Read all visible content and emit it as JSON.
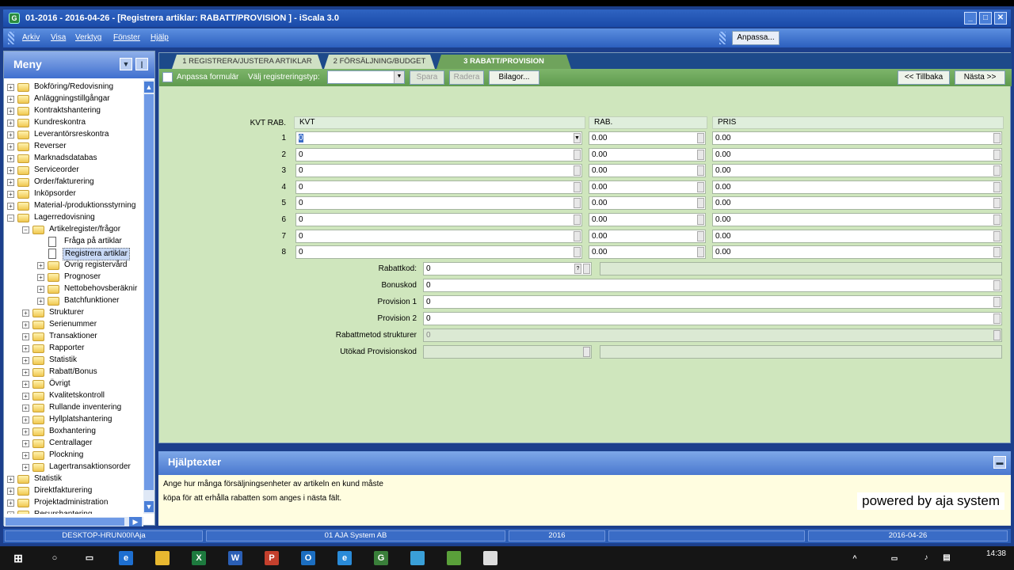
{
  "window": {
    "title": "01-2016 - 2016-04-26 - [Registrera artiklar: RABATT/PROVISION  ] - iScala 3.0"
  },
  "menubar": {
    "items": [
      "Arkiv",
      "Visa",
      "Verktyg",
      "Fönster",
      "Hjälp"
    ],
    "anpassa_label": "Anpassa..."
  },
  "sidebar": {
    "title": "Meny",
    "tree": [
      {
        "label": "Bokföring/Redovisning",
        "level": 0,
        "type": "folder",
        "expanded": false
      },
      {
        "label": "Anläggningstillgångar",
        "level": 0,
        "type": "folder",
        "expanded": false
      },
      {
        "label": "Kontraktshantering",
        "level": 0,
        "type": "folder",
        "expanded": false
      },
      {
        "label": "Kundreskontra",
        "level": 0,
        "type": "folder",
        "expanded": false
      },
      {
        "label": "Leverantörsreskontra",
        "level": 0,
        "type": "folder",
        "expanded": false
      },
      {
        "label": "Reverser",
        "level": 0,
        "type": "folder",
        "expanded": false
      },
      {
        "label": "Marknadsdatabas",
        "level": 0,
        "type": "folder",
        "expanded": false
      },
      {
        "label": "Serviceorder",
        "level": 0,
        "type": "folder",
        "expanded": false
      },
      {
        "label": "Order/fakturering",
        "level": 0,
        "type": "folder",
        "expanded": false
      },
      {
        "label": "Inköpsorder",
        "level": 0,
        "type": "folder",
        "expanded": false
      },
      {
        "label": "Material-/produktionsstyrning",
        "level": 0,
        "type": "folder",
        "expanded": false
      },
      {
        "label": "Lagerredovisning",
        "level": 0,
        "type": "folder",
        "expanded": true
      },
      {
        "label": "Artikelregister/frågor",
        "level": 1,
        "type": "folder",
        "expanded": true
      },
      {
        "label": "Fråga på artiklar",
        "level": 2,
        "type": "doc"
      },
      {
        "label": "Registrera artiklar",
        "level": 2,
        "type": "doc",
        "selected": true
      },
      {
        "label": "Övrig registervård",
        "level": 2,
        "type": "folder",
        "expanded": false
      },
      {
        "label": "Prognoser",
        "level": 2,
        "type": "folder",
        "expanded": false
      },
      {
        "label": "Nettobehovsberäknir",
        "level": 2,
        "type": "folder",
        "expanded": false
      },
      {
        "label": "Batchfunktioner",
        "level": 2,
        "type": "folder",
        "expanded": false
      },
      {
        "label": "Strukturer",
        "level": 1,
        "type": "folder",
        "expanded": false
      },
      {
        "label": "Serienummer",
        "level": 1,
        "type": "folder",
        "expanded": false
      },
      {
        "label": "Transaktioner",
        "level": 1,
        "type": "folder",
        "expanded": false
      },
      {
        "label": "Rapporter",
        "level": 1,
        "type": "folder",
        "expanded": false
      },
      {
        "label": "Statistik",
        "level": 1,
        "type": "folder",
        "expanded": false
      },
      {
        "label": "Rabatt/Bonus",
        "level": 1,
        "type": "folder",
        "expanded": false
      },
      {
        "label": "Övrigt",
        "level": 1,
        "type": "folder",
        "expanded": false
      },
      {
        "label": "Kvalitetskontroll",
        "level": 1,
        "type": "folder",
        "expanded": false
      },
      {
        "label": "Rullande inventering",
        "level": 1,
        "type": "folder",
        "expanded": false
      },
      {
        "label": "Hyllplatshantering",
        "level": 1,
        "type": "folder",
        "expanded": false
      },
      {
        "label": "Boxhantering",
        "level": 1,
        "type": "folder",
        "expanded": false
      },
      {
        "label": "Centrallager",
        "level": 1,
        "type": "folder",
        "expanded": false
      },
      {
        "label": "Plockning",
        "level": 1,
        "type": "folder",
        "expanded": false
      },
      {
        "label": "Lagertransaktionsorder",
        "level": 1,
        "type": "folder",
        "expanded": false
      },
      {
        "label": "Statistik",
        "level": 0,
        "type": "folder",
        "expanded": false
      },
      {
        "label": "Direktfakturering",
        "level": 0,
        "type": "folder",
        "expanded": false
      },
      {
        "label": "Projektadministration",
        "level": 0,
        "type": "folder",
        "expanded": false
      },
      {
        "label": "Resurshantering",
        "level": 0,
        "type": "folder",
        "expanded": false
      }
    ]
  },
  "tabs": [
    {
      "label": "1 REGISTRERA/JUSTERA ARTIKLAR",
      "active": false
    },
    {
      "label": "2 FÖRSÄLJNING/BUDGET",
      "active": false
    },
    {
      "label": "3 RABATT/PROVISION",
      "active": true
    }
  ],
  "toolbar": {
    "anpassa_formular": "Anpassa formulär",
    "valj_typ_label": "Välj registreringstyp:",
    "valj_typ_value": "",
    "spara": "Spara",
    "radera": "Radera",
    "bilagor": "Bilagor...",
    "tillbaka": "<< Tillbaka",
    "nasta": "Nästa >>"
  },
  "grid": {
    "headers": {
      "kvt_rab": "KVT RAB.",
      "kvt": "KVT",
      "rab": "RAB.",
      "pris": "PRIS"
    },
    "rows": [
      {
        "num": "1",
        "kvt": "0",
        "rab": "0.00",
        "pris": "0.00"
      },
      {
        "num": "2",
        "kvt": "0",
        "rab": "0.00",
        "pris": "0.00"
      },
      {
        "num": "3",
        "kvt": "0",
        "rab": "0.00",
        "pris": "0.00"
      },
      {
        "num": "4",
        "kvt": "0",
        "rab": "0.00",
        "pris": "0.00"
      },
      {
        "num": "5",
        "kvt": "0",
        "rab": "0.00",
        "pris": "0.00"
      },
      {
        "num": "6",
        "kvt": "0",
        "rab": "0.00",
        "pris": "0.00"
      },
      {
        "num": "7",
        "kvt": "0",
        "rab": "0.00",
        "pris": "0.00"
      },
      {
        "num": "8",
        "kvt": "0",
        "rab": "0.00",
        "pris": "0.00"
      }
    ]
  },
  "form": {
    "rabattkod": {
      "label": "Rabattkod:",
      "value": "0"
    },
    "bonuskod": {
      "label": "Bonuskod",
      "value": "0"
    },
    "provision1": {
      "label": "Provision 1",
      "value": "0"
    },
    "provision2": {
      "label": "Provision 2",
      "value": "0"
    },
    "rabattmetod": {
      "label": "Rabattmetod strukturer",
      "value": "0"
    },
    "utokad": {
      "label": "Utökad Provisionskod",
      "value": ""
    }
  },
  "help": {
    "title": "Hjälptexter",
    "line1": "Ange hur många försäljningsenheter av artikeln en kund måste",
    "line2": "köpa för att erhålla rabatten som anges i nästa fält.",
    "watermark": "powered by aja system"
  },
  "statusbar": {
    "computer": "DESKTOP-HRUN00I\\Aja",
    "company": "01 AJA System AB",
    "year": "2016",
    "date": "2016-04-26"
  },
  "taskbar": {
    "time": "14:38"
  },
  "colors": {
    "accent": "#1c3f8c",
    "panel_green": "#cfe6bd",
    "toolbar_green": "#6fa35c",
    "help_bg": "#fffde0"
  }
}
